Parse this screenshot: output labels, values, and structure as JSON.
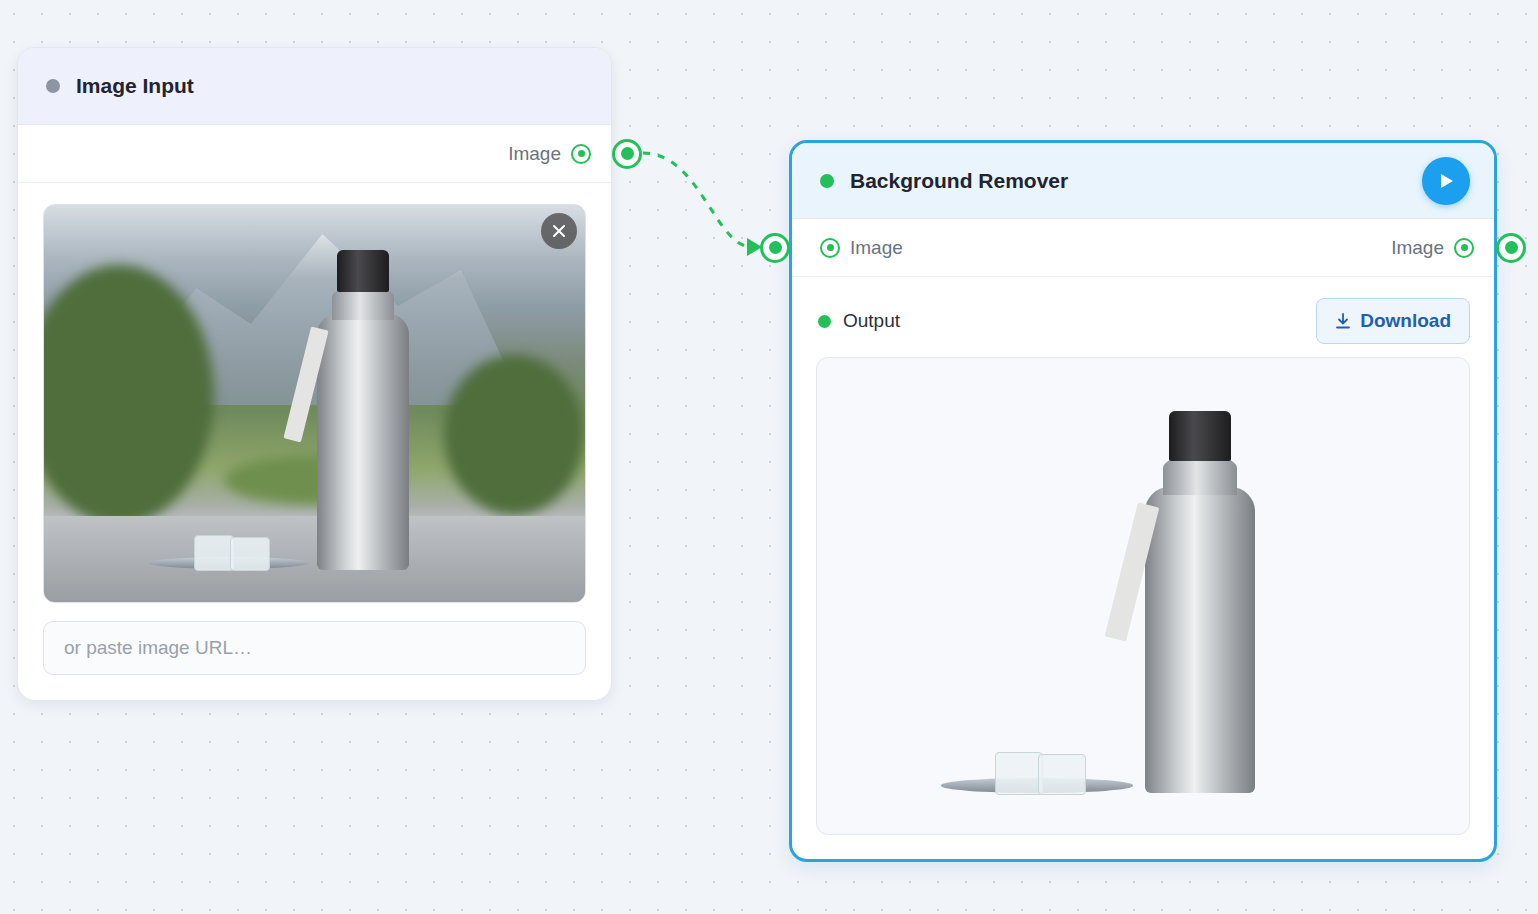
{
  "nodes": [
    {
      "kind": "input",
      "title": "Image Input",
      "color": "#8e95a2",
      "selected": false,
      "outputs": [
        "Image"
      ],
      "image": {
        "loaded": true
      },
      "url_field": {
        "placeholder": "or paste image URL…"
      }
    },
    {
      "kind": "processor",
      "title": "Background Remover",
      "color": "#22c05a",
      "selected": true,
      "inputs": [
        "Image"
      ],
      "outputs": [
        "Image"
      ],
      "result": {
        "label": "Output",
        "color": "#22c05a",
        "download": "Download",
        "loaded": true
      }
    }
  ],
  "edges": [
    {
      "dashed": true
    }
  ]
}
